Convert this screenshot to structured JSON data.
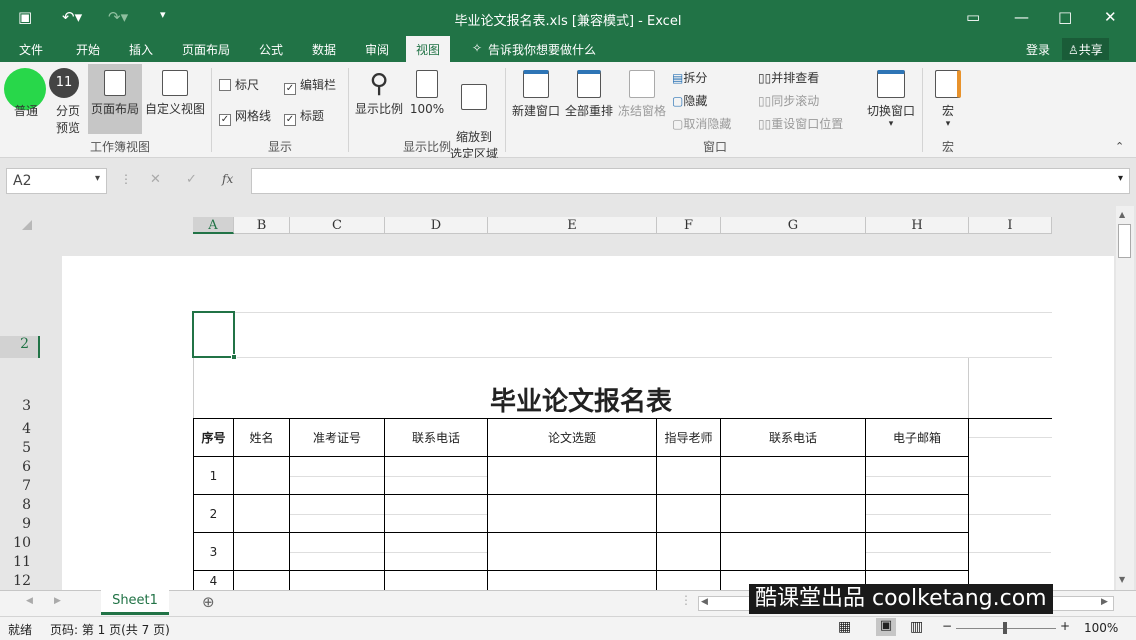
{
  "window": {
    "title": "毕业论文报名表.xls  [兼容模式] - Excel",
    "restore": "□"
  },
  "tabs": [
    "文件",
    "开始",
    "插入",
    "页面布局",
    "公式",
    "数据",
    "审阅",
    "视图"
  ],
  "tell_me": "告诉我你想要做什么",
  "account": {
    "login": "登录",
    "share": "共享"
  },
  "ribbon": {
    "workbook_views": {
      "label": "工作簿视图",
      "normal": "普通",
      "page_break": "分页\n预览",
      "page_layout": "页面布局",
      "custom": "自定义视图"
    },
    "show": {
      "label": "显示",
      "ruler": "标尺",
      "formula_bar": "编辑栏",
      "gridlines": "网格线",
      "headings": "标题"
    },
    "zoom": {
      "label": "显示比例",
      "zoom": "显示比例",
      "hundred": "100%",
      "to_selection": "缩放到\n选定区域"
    },
    "window": {
      "label": "窗口",
      "new_window": "新建窗口",
      "arrange_all": "全部重排",
      "freeze": "冻结窗格",
      "split": "拆分",
      "hide": "隐藏",
      "unhide": "取消隐藏",
      "side_by_side": "并排查看",
      "sync_scroll": "同步滚动",
      "reset_pos": "重设窗口位置",
      "switch": "切换窗口"
    },
    "macros": {
      "label": "宏",
      "macro": "宏"
    }
  },
  "step_badge": "11",
  "namebox": "A2",
  "columns": [
    "A",
    "B",
    "C",
    "D",
    "E",
    "F",
    "G",
    "H",
    "I"
  ],
  "rows": [
    "2",
    "3",
    "4",
    "5",
    "6",
    "7",
    "8",
    "9",
    "10",
    "11",
    "12"
  ],
  "sheet": {
    "title": "毕业论文报名表",
    "headers": [
      "序号",
      "姓名",
      "准考证号",
      "联系电话",
      "论文选题",
      "指导老师",
      "联系电话",
      "电子邮箱"
    ],
    "row_numbers": [
      "1",
      "2",
      "3",
      "4"
    ]
  },
  "sheet_tab": "Sheet1",
  "status": {
    "ready": "就绪",
    "page": "页码: 第 1 页(共 7 页)",
    "zoom": "100%"
  },
  "watermark": "酷课堂出品 coolketang.com"
}
